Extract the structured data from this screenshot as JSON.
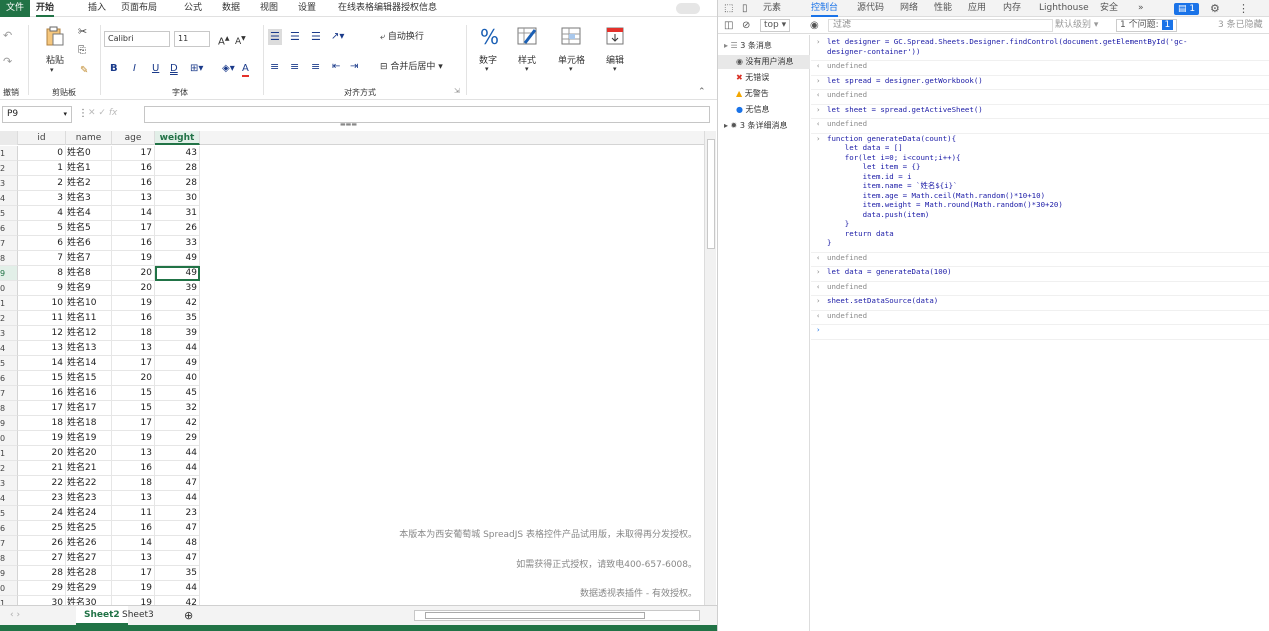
{
  "excel": {
    "menu": [
      "文件",
      "开始",
      "插入",
      "页面布局",
      "公式",
      "数据",
      "视图",
      "设置",
      "在线表格编辑器授权信息"
    ],
    "ribbon": {
      "undo_label": "撤销",
      "paste_label": "粘贴",
      "clipboard_group": "剪贴板",
      "font_name": "Calibri",
      "font_size": "11",
      "font_group": "字体",
      "wrap_text": "自动换行",
      "merge_center": "合并后居中",
      "align_group": "对齐方式",
      "number_label": "数字",
      "style_label": "样式",
      "cells_label": "单元格",
      "edit_label": "编辑",
      "inc_font": "A",
      "dec_font": "A",
      "bold": "B",
      "italic": "I",
      "underline": "U",
      "double_underline": "D",
      "font_color": "A"
    },
    "name_box": "P9",
    "fx": "fx",
    "columns": [
      "id",
      "name",
      "age",
      "weight"
    ],
    "rows": [
      {
        "rn": "1",
        "id": "0",
        "name": "姓名0",
        "age": "17",
        "weight": "43"
      },
      {
        "rn": "2",
        "id": "1",
        "name": "姓名1",
        "age": "16",
        "weight": "28"
      },
      {
        "rn": "3",
        "id": "2",
        "name": "姓名2",
        "age": "16",
        "weight": "28"
      },
      {
        "rn": "4",
        "id": "3",
        "name": "姓名3",
        "age": "13",
        "weight": "30"
      },
      {
        "rn": "5",
        "id": "4",
        "name": "姓名4",
        "age": "14",
        "weight": "31"
      },
      {
        "rn": "6",
        "id": "5",
        "name": "姓名5",
        "age": "17",
        "weight": "26"
      },
      {
        "rn": "7",
        "id": "6",
        "name": "姓名6",
        "age": "16",
        "weight": "33"
      },
      {
        "rn": "8",
        "id": "7",
        "name": "姓名7",
        "age": "19",
        "weight": "49"
      },
      {
        "rn": "9",
        "id": "8",
        "name": "姓名8",
        "age": "20",
        "weight": "49"
      },
      {
        "rn": "0",
        "id": "9",
        "name": "姓名9",
        "age": "20",
        "weight": "39"
      },
      {
        "rn": "1",
        "id": "10",
        "name": "姓名10",
        "age": "19",
        "weight": "42"
      },
      {
        "rn": "2",
        "id": "11",
        "name": "姓名11",
        "age": "16",
        "weight": "35"
      },
      {
        "rn": "3",
        "id": "12",
        "name": "姓名12",
        "age": "18",
        "weight": "39"
      },
      {
        "rn": "4",
        "id": "13",
        "name": "姓名13",
        "age": "13",
        "weight": "44"
      },
      {
        "rn": "5",
        "id": "14",
        "name": "姓名14",
        "age": "17",
        "weight": "49"
      },
      {
        "rn": "6",
        "id": "15",
        "name": "姓名15",
        "age": "20",
        "weight": "40"
      },
      {
        "rn": "7",
        "id": "16",
        "name": "姓名16",
        "age": "15",
        "weight": "45"
      },
      {
        "rn": "8",
        "id": "17",
        "name": "姓名17",
        "age": "15",
        "weight": "32"
      },
      {
        "rn": "9",
        "id": "18",
        "name": "姓名18",
        "age": "17",
        "weight": "42"
      },
      {
        "rn": "0",
        "id": "19",
        "name": "姓名19",
        "age": "19",
        "weight": "29"
      },
      {
        "rn": "1",
        "id": "20",
        "name": "姓名20",
        "age": "13",
        "weight": "44"
      },
      {
        "rn": "2",
        "id": "21",
        "name": "姓名21",
        "age": "16",
        "weight": "44"
      },
      {
        "rn": "3",
        "id": "22",
        "name": "姓名22",
        "age": "18",
        "weight": "47"
      },
      {
        "rn": "4",
        "id": "23",
        "name": "姓名23",
        "age": "13",
        "weight": "44"
      },
      {
        "rn": "5",
        "id": "24",
        "name": "姓名24",
        "age": "11",
        "weight": "23"
      },
      {
        "rn": "6",
        "id": "25",
        "name": "姓名25",
        "age": "16",
        "weight": "47"
      },
      {
        "rn": "7",
        "id": "26",
        "name": "姓名26",
        "age": "14",
        "weight": "48"
      },
      {
        "rn": "8",
        "id": "27",
        "name": "姓名27",
        "age": "13",
        "weight": "47"
      },
      {
        "rn": "9",
        "id": "28",
        "name": "姓名28",
        "age": "17",
        "weight": "35"
      },
      {
        "rn": "0",
        "id": "29",
        "name": "姓名29",
        "age": "19",
        "weight": "44"
      },
      {
        "rn": "1",
        "id": "30",
        "name": "姓名30",
        "age": "19",
        "weight": "42"
      }
    ],
    "watermark": [
      "本版本为西安葡萄城 SpreadJS 表格控件产品试用版，未取得再分发授权。",
      "如需获得正式授权，请致电400-657-6008。",
      "数据透视表插件 - 有效授权。"
    ],
    "sheet_tabs": [
      "Sheet2",
      "Sheet3"
    ]
  },
  "devtools": {
    "tabs": [
      "元素",
      "控制台",
      "源代码",
      "网络",
      "性能",
      "应用",
      "内存",
      "Lighthouse",
      "安全"
    ],
    "active_tab": "控制台",
    "badge_count": "1",
    "context": "top",
    "filter_placeholder": "过滤",
    "default_levels": "默认级别",
    "issues": "1 个问题:",
    "issues_count": "1",
    "hidden": "3 条已隐藏",
    "sidebar": [
      {
        "label": "3 条消息",
        "icon": "list-icon"
      },
      {
        "label": "没有用户消息",
        "icon": "user-icon"
      },
      {
        "label": "无错误",
        "icon": "error-icon"
      },
      {
        "label": "无警告",
        "icon": "warning-icon"
      },
      {
        "label": "无信息",
        "icon": "info-icon"
      },
      {
        "label": "3 条详细消息",
        "icon": "bug-icon"
      }
    ],
    "console": [
      {
        "type": "in",
        "text": "let designer = GC.Spread.Sheets.Designer.findControl(document.getElementById('gc-\ndesigner-container'))"
      },
      {
        "type": "out",
        "text": "undefined"
      },
      {
        "type": "in",
        "text": "let spread = designer.getWorkbook()"
      },
      {
        "type": "out",
        "text": "undefined"
      },
      {
        "type": "in",
        "text": "let sheet = spread.getActiveSheet()"
      },
      {
        "type": "out",
        "text": "undefined"
      },
      {
        "type": "in",
        "text": "function generateData(count){\n    let data = []\n    for(let i=0; i<count;i++){\n        let item = {}\n        item.id = i\n        item.name = `姓名${i}`\n        item.age = Math.ceil(Math.random()*10+10)\n        item.weight = Math.round(Math.random()*30+20)\n        data.push(item)\n    }\n    return data\n}"
      },
      {
        "type": "out",
        "text": "undefined"
      },
      {
        "type": "in",
        "text": "let data = generateData(100)"
      },
      {
        "type": "out",
        "text": "undefined"
      },
      {
        "type": "in",
        "text": "sheet.setDataSource(data)"
      },
      {
        "type": "out",
        "text": "undefined"
      },
      {
        "type": "prompt",
        "text": ""
      }
    ]
  }
}
